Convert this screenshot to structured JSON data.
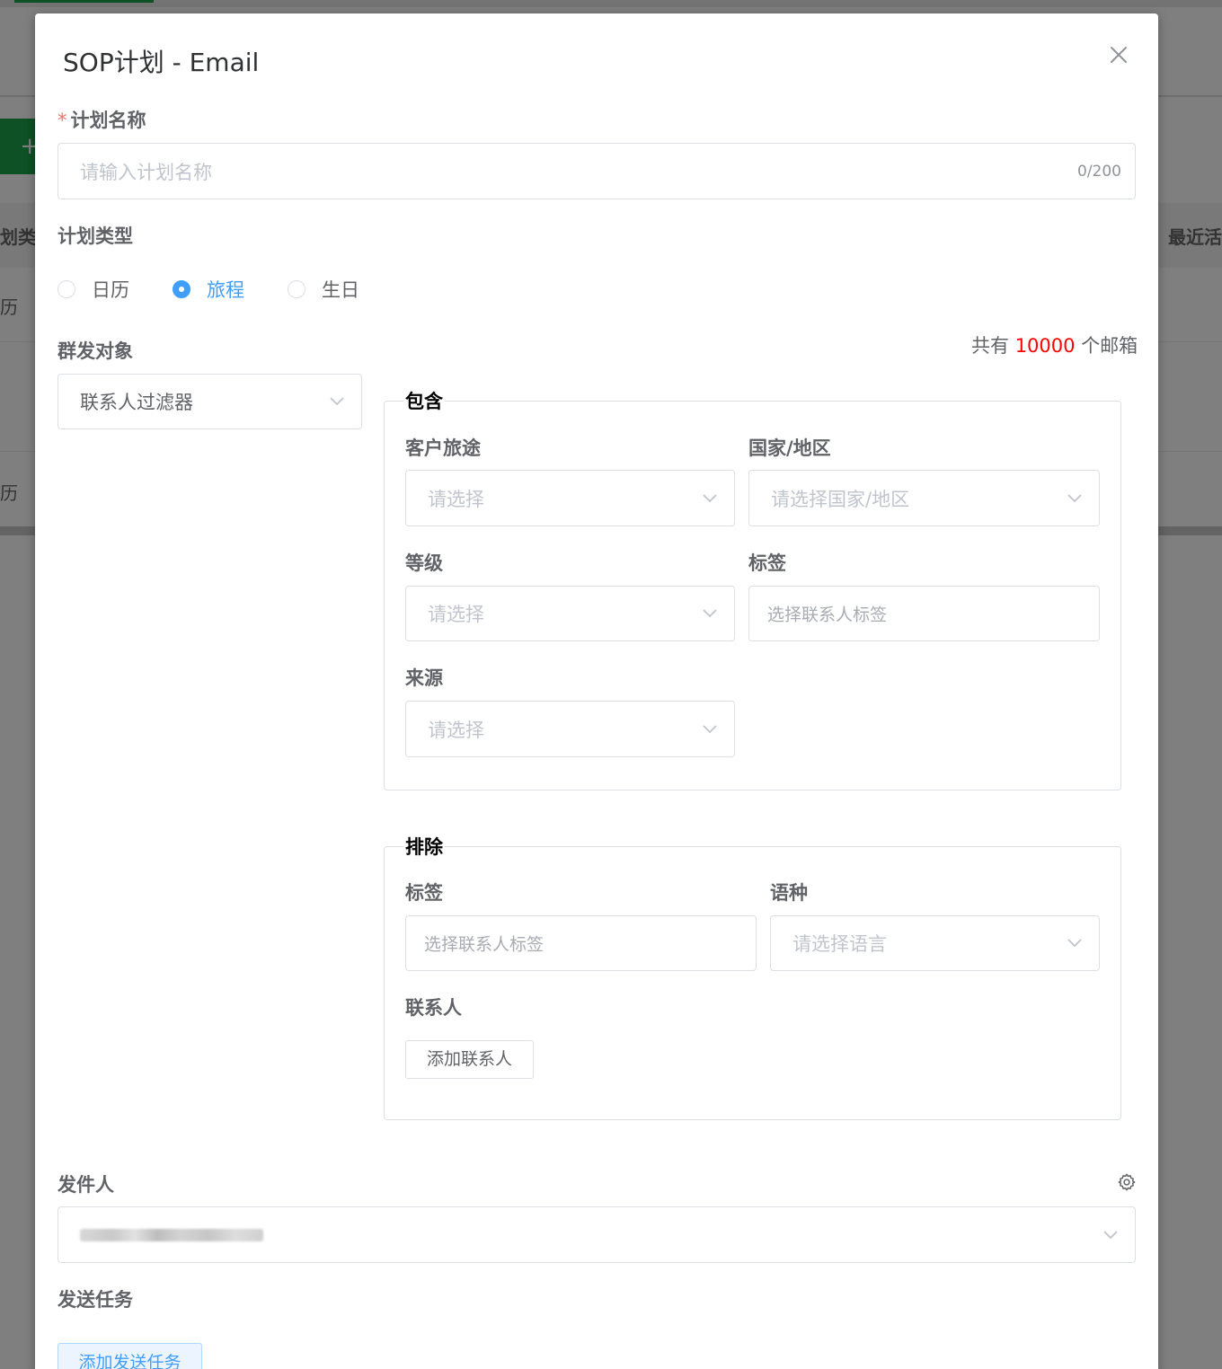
{
  "background": {
    "add_label": "+",
    "col_left": "划类",
    "col_right": "最近活",
    "row1": "历",
    "row2": "历"
  },
  "dialog": {
    "title": "SOP计划 - Email"
  },
  "plan_name": {
    "required_mark": "*",
    "label": "计划名称",
    "placeholder": "请输入计划名称",
    "value": "",
    "counter": "0/200"
  },
  "plan_type": {
    "label": "计划类型",
    "options": [
      {
        "label": "日历",
        "selected": false
      },
      {
        "label": "旅程",
        "selected": true
      },
      {
        "label": "生日",
        "selected": false
      }
    ]
  },
  "audience": {
    "label": "群发对象",
    "select_value": "联系人过滤器",
    "count_prefix": "共有",
    "count_value": "10000",
    "count_suffix": "个邮箱"
  },
  "include": {
    "legend": "包含",
    "journey_label": "客户旅途",
    "journey_placeholder": "请选择",
    "country_label": "国家/地区",
    "country_placeholder": "请选择国家/地区",
    "level_label": "等级",
    "level_placeholder": "请选择",
    "tag_label": "标签",
    "tag_placeholder": "选择联系人标签",
    "source_label": "来源",
    "source_placeholder": "请选择"
  },
  "exclude": {
    "legend": "排除",
    "tag_label": "标签",
    "tag_placeholder": "选择联系人标签",
    "language_label": "语种",
    "language_placeholder": "请选择语言",
    "contact_label": "联系人",
    "add_contact_button": "添加联系人"
  },
  "sender": {
    "label": "发件人"
  },
  "send_task": {
    "label": "发送任务",
    "add_button": "添加发送任务"
  },
  "colors": {
    "primary": "#409eff",
    "required": "#f56c6c",
    "count": "#ff0000",
    "bg_green": "#1aa34a"
  }
}
